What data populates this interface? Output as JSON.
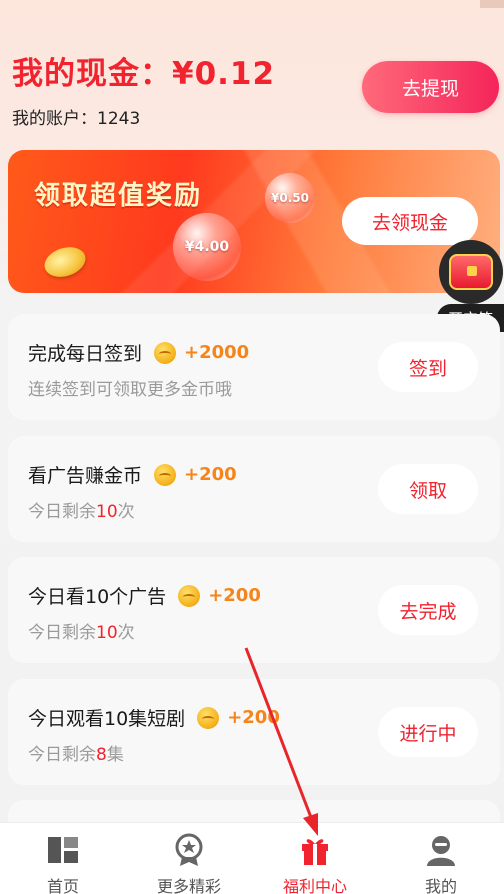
{
  "header": {
    "cash_label": "我的现金：¥0.12",
    "account_label": "我的账户：1243",
    "withdraw_button": "去提现"
  },
  "banner": {
    "title": "领取超值奖励",
    "bubble_small": "¥0.50",
    "bubble_large": "¥4.00",
    "claim_button": "去领现金"
  },
  "treasure_chest": {
    "label": "开宝箱"
  },
  "tasks": [
    {
      "title": "完成每日签到",
      "reward": "+2000",
      "sub_prefix": "连续签到可领取更多金币哦",
      "sub_num": "",
      "sub_suffix": "",
      "button": "签到"
    },
    {
      "title": "看广告赚金币",
      "reward": "+200",
      "sub_prefix": "今日剩余",
      "sub_num": "10",
      "sub_suffix": "次",
      "button": "领取"
    },
    {
      "title": "今日看10个广告",
      "reward": "+200",
      "sub_prefix": "今日剩余",
      "sub_num": "10",
      "sub_suffix": "次",
      "button": "去完成"
    },
    {
      "title": "今日观看10集短剧",
      "reward": "+200",
      "sub_prefix": "今日剩余",
      "sub_num": "8",
      "sub_suffix": "集",
      "button": "进行中"
    }
  ],
  "tabbar": [
    {
      "label": "首页",
      "icon": "home-grid-icon"
    },
    {
      "label": "更多精彩",
      "icon": "badge-star-icon"
    },
    {
      "label": "福利中心",
      "icon": "gift-icon"
    },
    {
      "label": "我的",
      "icon": "user-icon"
    }
  ],
  "colors": {
    "accent": "#f0232f",
    "reward": "#f5851a",
    "active_tab": "#f0232f"
  }
}
